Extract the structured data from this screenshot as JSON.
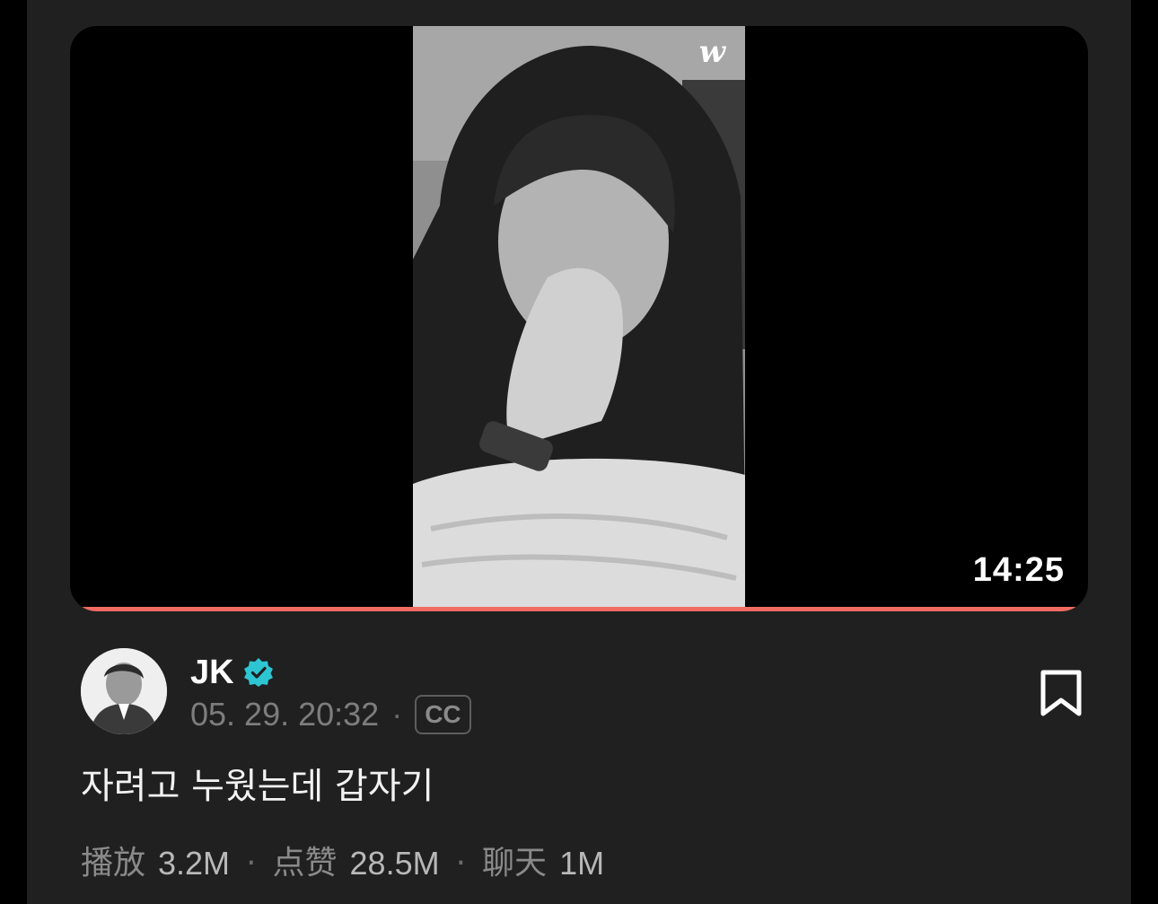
{
  "video": {
    "duration": "14:25",
    "watermark": "w",
    "progress": 1.0,
    "progress_color": "#ef6b63"
  },
  "post": {
    "author": "JK",
    "verified": true,
    "verified_color": "#2ec5d3",
    "date": "05. 29. 20:32",
    "cc_label": "CC",
    "caption": "자려고 누웠는데 갑자기"
  },
  "stats": [
    {
      "label": "播放",
      "value": "3.2M"
    },
    {
      "label": "点赞",
      "value": "28.5M"
    },
    {
      "label": "聊天",
      "value": "1M"
    }
  ],
  "icons": {
    "verified": "verified-badge-icon",
    "bookmark": "bookmark-icon"
  }
}
